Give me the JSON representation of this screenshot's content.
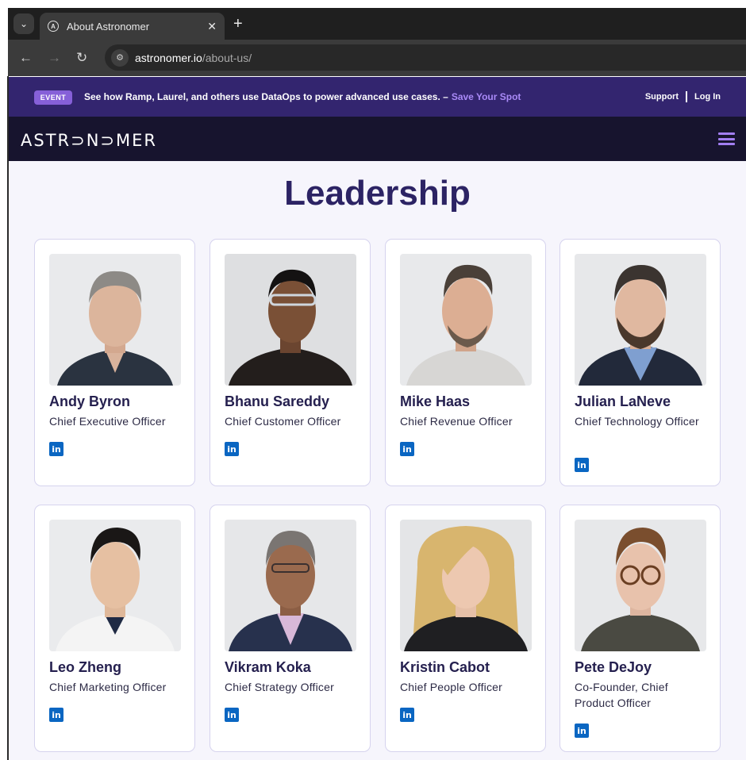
{
  "browser": {
    "tab_title": "About Astronomer",
    "url_host": "astronomer.io",
    "url_path": "/about-us/"
  },
  "banner": {
    "badge": "EVENT",
    "message": "See how Ramp, Laurel, and others use DataOps to power advanced use cases. –",
    "link": "Save Your Spot",
    "support": "Support",
    "login": "Log In"
  },
  "header": {
    "logo": "ASTR⊃N⊃MER"
  },
  "page": {
    "heading": "Leadership"
  },
  "leaders": [
    {
      "name": "Andy Byron",
      "title": "Chief Executive Officer"
    },
    {
      "name": "Bhanu Sareddy",
      "title": "Chief Customer Officer"
    },
    {
      "name": "Mike Haas",
      "title": "Chief Revenue Officer"
    },
    {
      "name": "Julian LaNeve",
      "title": "Chief Technology Officer"
    },
    {
      "name": "Leo Zheng",
      "title": "Chief Marketing Officer"
    },
    {
      "name": "Vikram Koka",
      "title": "Chief Strategy Officer"
    },
    {
      "name": "Kristin Cabot",
      "title": "Chief People Officer"
    },
    {
      "name": "Pete DeJoy",
      "title": "Co-Founder, Chief Product Officer"
    }
  ],
  "linkedin_icon": "linkedin-icon",
  "colors": {
    "banner_bg": "#33256f",
    "header_bg": "#17142e",
    "accent": "#a27ef2",
    "heading": "#2c2364",
    "linkedin": "#0a66c2"
  }
}
